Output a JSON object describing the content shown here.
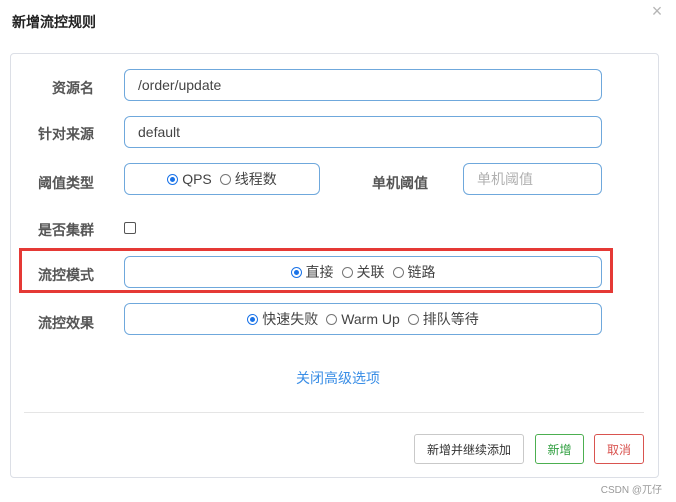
{
  "dialog": {
    "title": "新增流控规则",
    "close_symbol": "×"
  },
  "form": {
    "resource": {
      "label": "资源名",
      "value": "/order/update"
    },
    "limit_app": {
      "label": "针对来源",
      "value": "default"
    },
    "grade": {
      "label": "阈值类型",
      "options": [
        "QPS",
        "线程数"
      ],
      "selected": "QPS"
    },
    "count": {
      "label": "单机阈值",
      "placeholder": "单机阈值"
    },
    "cluster": {
      "label": "是否集群",
      "checked": false
    },
    "strategy": {
      "label": "流控模式",
      "options": [
        "直接",
        "关联",
        "链路"
      ],
      "selected": "直接"
    },
    "control_behavior": {
      "label": "流控效果",
      "options": [
        "快速失败",
        "Warm Up",
        "排队等待"
      ],
      "selected": "快速失败"
    },
    "advanced_toggle": "关闭高级选项"
  },
  "footer": {
    "continue_label": "新增并继续添加",
    "add_label": "新增",
    "cancel_label": "取消"
  },
  "watermark": "CSDN @兀仔",
  "colors": {
    "input_border": "#6fa8dc",
    "highlight": "#e53935",
    "link": "#3a8ee6",
    "add_green": "#4caf50",
    "cancel_red": "#d9534f"
  }
}
